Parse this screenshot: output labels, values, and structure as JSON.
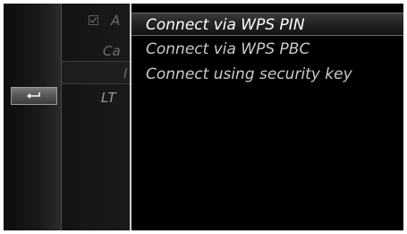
{
  "background_menu": {
    "items": [
      {
        "label": "A",
        "checked": true
      },
      {
        "label": "Ca"
      },
      {
        "label": "I"
      },
      {
        "label": "LT"
      }
    ]
  },
  "back_button": {
    "icon": "back-arrow-icon"
  },
  "popup_menu": {
    "items": [
      {
        "label": "Connect via WPS PIN",
        "selected": true
      },
      {
        "label": "Connect via WPS PBC"
      },
      {
        "label": "Connect using security key"
      }
    ]
  },
  "colors": {
    "background": "#0a0a0a",
    "text_selected": "#ffffff",
    "text_normal": "#c9c9c9",
    "text_dimmed": "#6b6b6b"
  }
}
